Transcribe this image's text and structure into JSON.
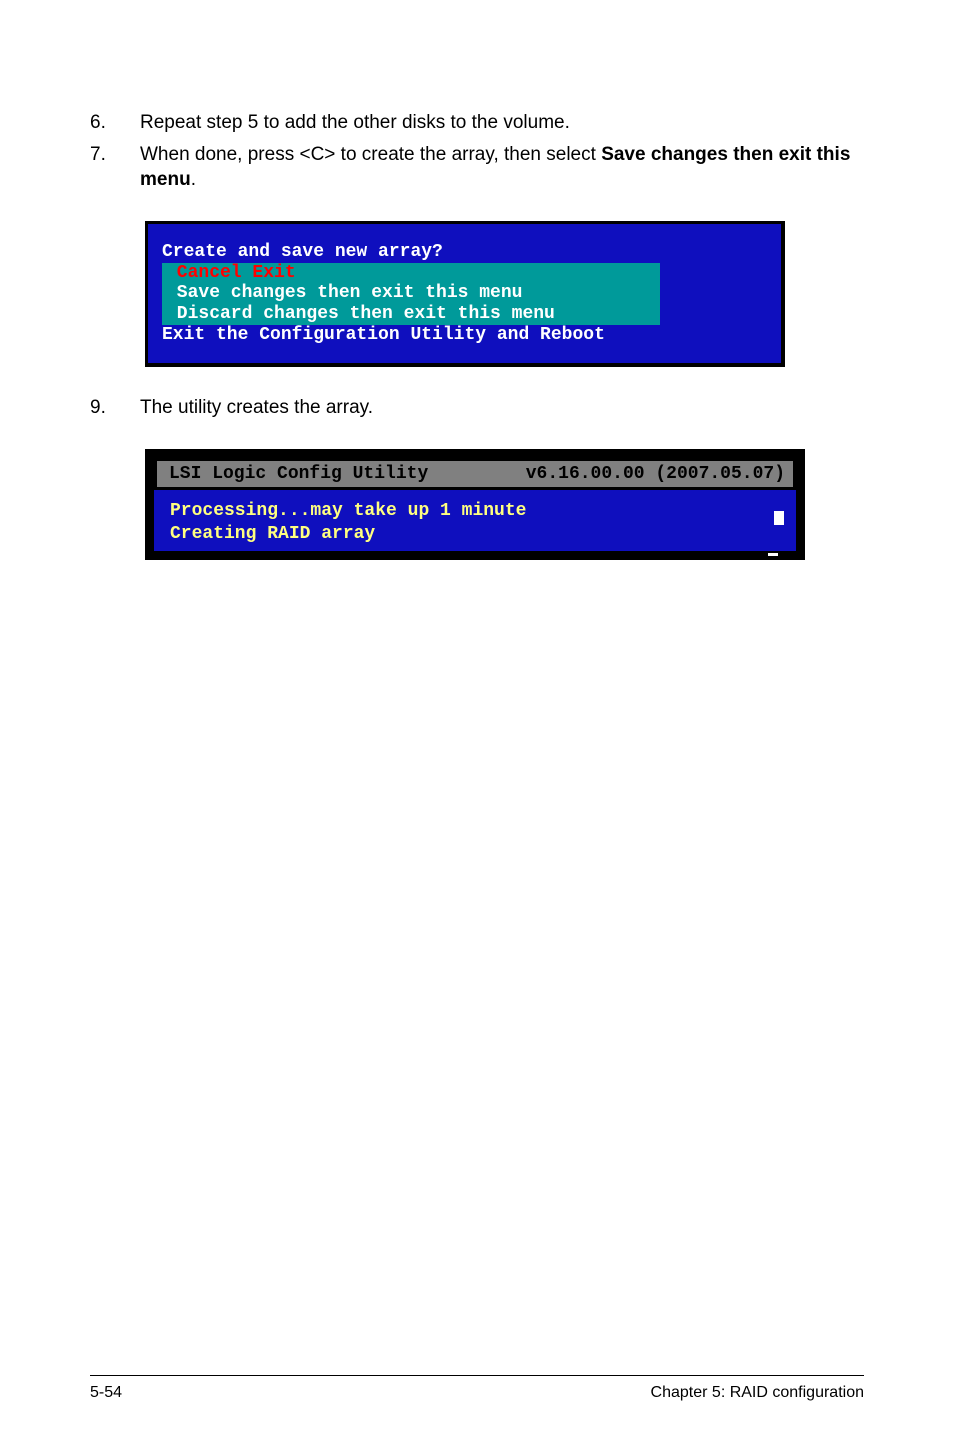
{
  "steps": [
    {
      "num": "6.",
      "text_plain": "Repeat step 5 to add the other disks to the volume."
    },
    {
      "num": "7.",
      "text_prefix": "When done, press <C> to create the array, then select ",
      "text_bold": "Save changes then exit this menu",
      "text_suffix": "."
    }
  ],
  "bios1": {
    "title": "Create and save new array?",
    "cancel": " Cancel Exit",
    "save": " Save changes then exit this menu",
    "discard": " Discard changes then exit this menu",
    "exit": "Exit the Configuration Utility and Reboot"
  },
  "step9_num": "9.",
  "step9_text": "The utility creates the array.",
  "bios2": {
    "header_left": "LSI Logic Config Utility",
    "header_right": "v6.16.00.00 (2007.05.07)",
    "line1": "Processing...may take up 1 minute",
    "line2": "Creating RAID array"
  },
  "footer": {
    "left": "5-54",
    "right": "Chapter 5: RAID configuration"
  }
}
